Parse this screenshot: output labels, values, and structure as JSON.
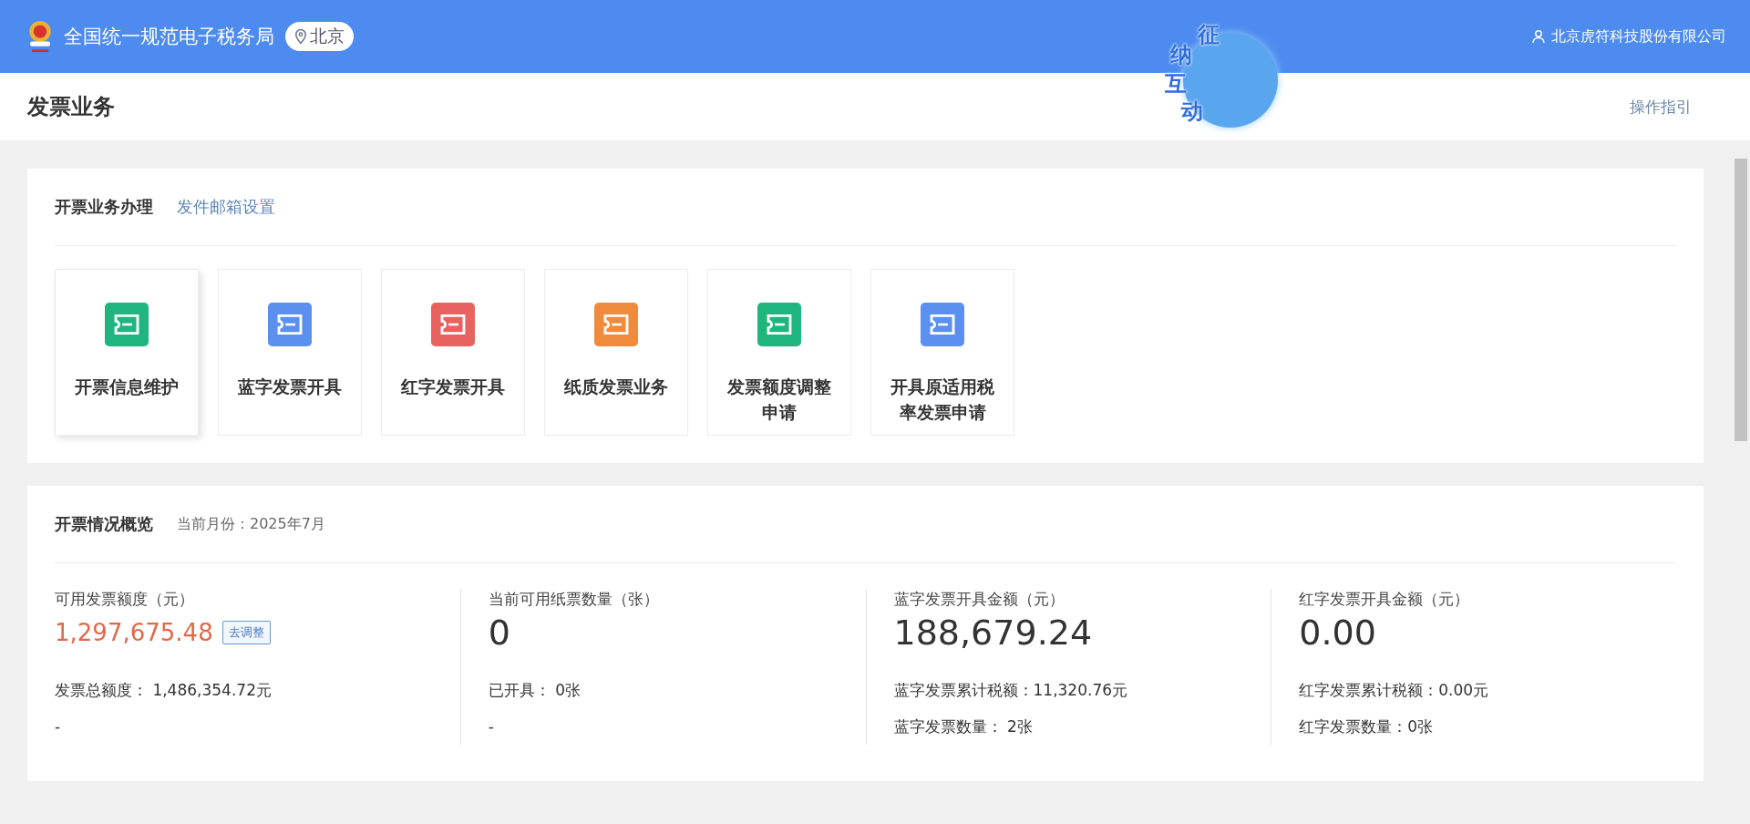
{
  "header": {
    "title": "全国统一规范电子税务局",
    "location": "北京",
    "mascot_text": [
      "征",
      "纳",
      "互",
      "动"
    ],
    "user": "北京虎符科技股份有限公司"
  },
  "page": {
    "title": "发票业务",
    "guide_link": "操作指引"
  },
  "business": {
    "title": "开票业务办理",
    "link": "发件邮箱设置",
    "tiles": [
      {
        "label": "开票信息维护",
        "color": "#1fb57f",
        "hovered": true
      },
      {
        "label": "蓝字发票开具",
        "color": "#5b8ff0",
        "hovered": false
      },
      {
        "label": "红字发票开具",
        "color": "#e8625f",
        "hovered": false
      },
      {
        "label": "纸质发票业务",
        "color": "#f08a3c",
        "hovered": false
      },
      {
        "label": "发票额度调整申请",
        "color": "#1fb57f",
        "hovered": false
      },
      {
        "label": "开具原适用税率发票申请",
        "color": "#5b8ff0",
        "hovered": false
      }
    ]
  },
  "overview": {
    "title": "开票情况概览",
    "month": "当前月份：2025年7月",
    "stats": [
      {
        "label": "可用发票额度（元）",
        "value": "1,297,675.48",
        "highlight": true,
        "action": "去调整",
        "lines": [
          "发票总额度： 1,486,354.72元",
          "-"
        ]
      },
      {
        "label": "当前可用纸票数量（张）",
        "value": "0",
        "highlight": false,
        "lines": [
          "已开具： 0张",
          "-"
        ]
      },
      {
        "label": "蓝字发票开具金额（元）",
        "value": "188,679.24",
        "highlight": false,
        "lines": [
          "蓝字发票累计税额：11,320.76元",
          "蓝字发票数量： 2张"
        ]
      },
      {
        "label": "红字发票开具金额（元）",
        "value": "0.00",
        "highlight": false,
        "lines": [
          "红字发票累计税额：0.00元",
          "红字发票数量：0张"
        ]
      }
    ]
  }
}
